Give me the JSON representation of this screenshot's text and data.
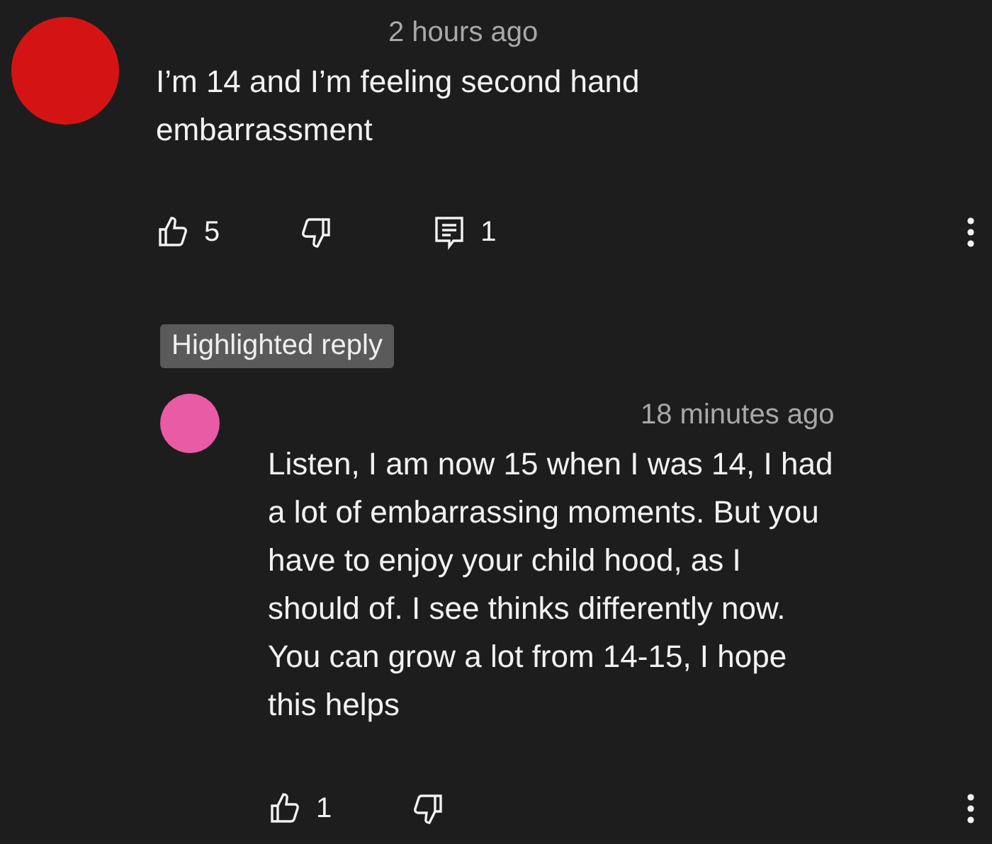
{
  "comments": [
    {
      "kind": "comment",
      "color": "#d41414",
      "time": "2 hours ago",
      "text": "I’m 14 and I’m feeling second hand\nembarrassment",
      "likes": "5",
      "replies": "1"
    },
    {
      "kind": "reply",
      "badge": "Highlighted reply",
      "color": "#ea5ba6",
      "time": "18 minutes ago",
      "text": "Listen, I am now 15 when I was 14, I had\na lot of embarrassing moments. But you\nhave to enjoy your child hood, as I\nshould of. I see thinks differently now.\nYou can grow a lot from 14-15, I hope\nthis helps",
      "likes": "1"
    }
  ]
}
